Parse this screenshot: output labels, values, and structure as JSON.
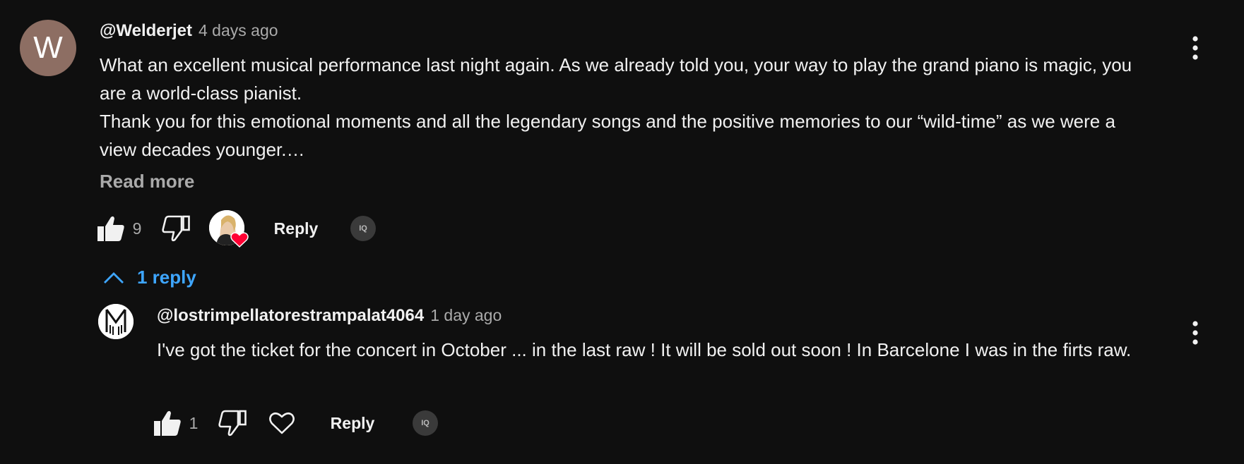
{
  "comment": {
    "avatar_letter": "W",
    "author": "@Welderjet",
    "time": "4 days ago",
    "paragraphs": [
      "What an excellent musical performance last night again. As we already told you, your way to play the grand piano is magic, you are a world-class pianist.",
      "Thank you for this emotional moments and all the legendary songs and the positive memories to our “wild-time” as we were a view decades younger.…"
    ],
    "read_more": "Read more",
    "likes": "9",
    "reply_label": "Reply",
    "ext_badge": "IQ",
    "more_icon": "vertical-ellipsis-icon"
  },
  "replies_toggle": {
    "label": "1 reply",
    "icon": "chevron-up-icon"
  },
  "reply": {
    "author": "@lostrimpellatorestrampalat4064",
    "time": "1 day ago",
    "text": "I've got the ticket for the concert in October ... in the last raw ! It will be sold out soon ! In Barcelone I was in the firts raw.",
    "likes": "1",
    "reply_label": "Reply",
    "ext_badge": "IQ",
    "more_icon": "vertical-ellipsis-icon"
  },
  "colors": {
    "background": "#0f0f0f",
    "text": "#f1f1f1",
    "muted": "#aaaaaa",
    "link": "#3ea6ff",
    "avatar": "#8d6e63",
    "heart": "#ff0033"
  }
}
